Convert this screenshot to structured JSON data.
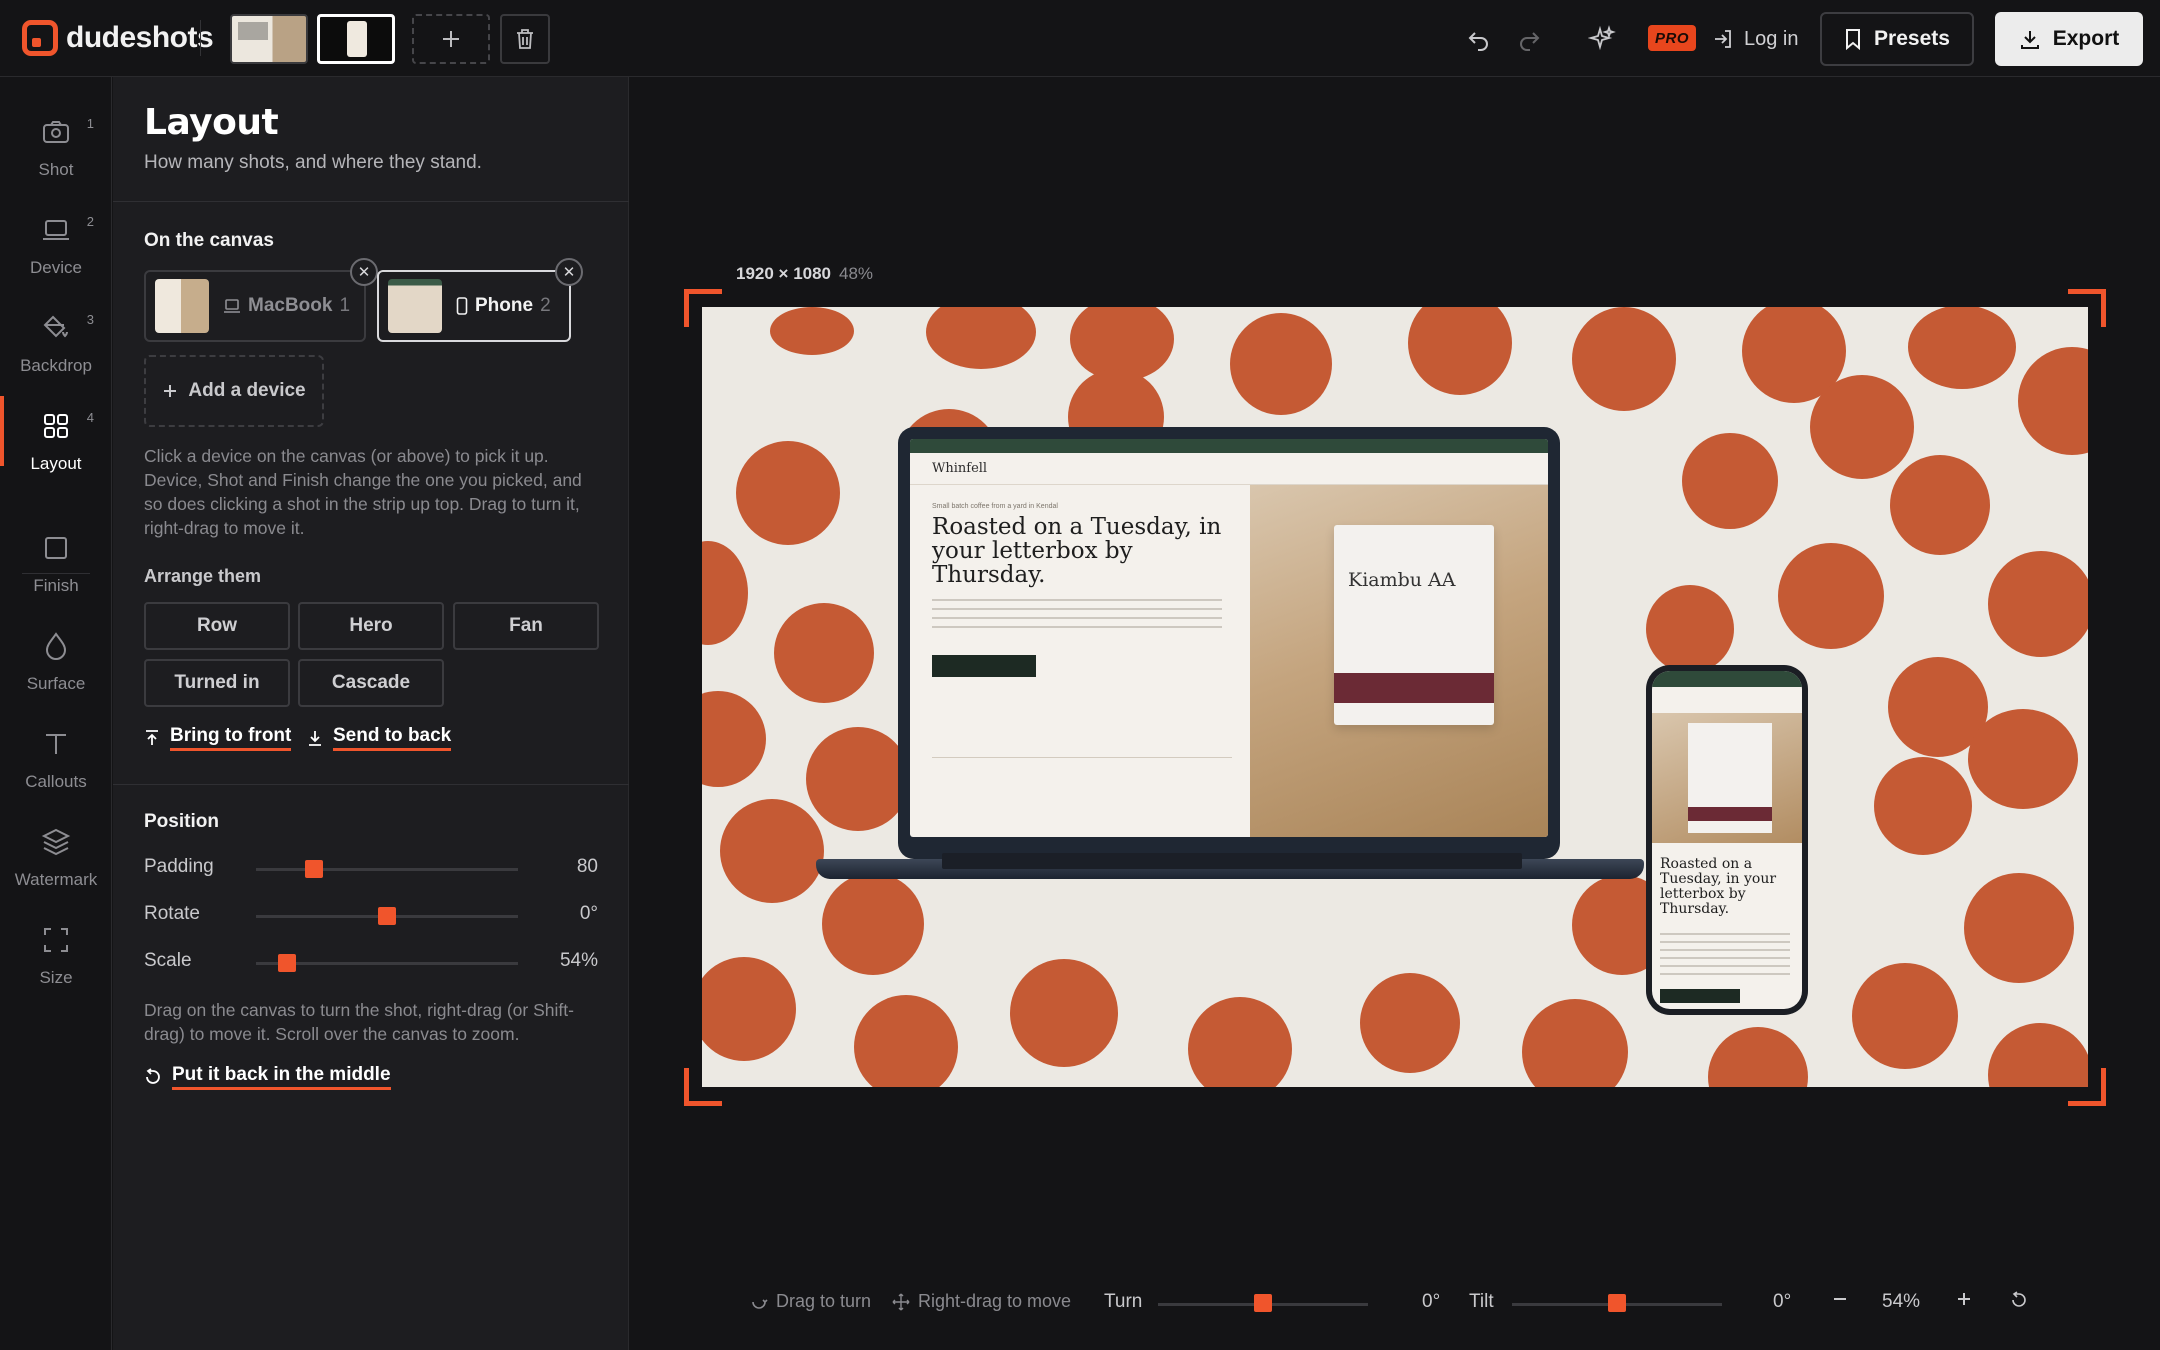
{
  "app": {
    "name": "dudeshots"
  },
  "topbar": {
    "login_label": "Log in",
    "presets_label": "Presets",
    "export_label": "Export",
    "pro_badge": "PRO"
  },
  "rail": {
    "items": [
      {
        "label": "Shot",
        "num": "1",
        "icon": "camera-icon"
      },
      {
        "label": "Device",
        "num": "2",
        "icon": "laptop-icon"
      },
      {
        "label": "Backdrop",
        "num": "3",
        "icon": "paint-bucket-icon"
      },
      {
        "label": "Layout",
        "num": "4",
        "icon": "grid-icon",
        "active": true
      },
      {
        "label": "Finish",
        "icon": "square-icon"
      },
      {
        "label": "Surface",
        "icon": "droplet-icon"
      },
      {
        "label": "Callouts",
        "icon": "text-icon"
      },
      {
        "label": "Watermark",
        "icon": "layers-icon"
      },
      {
        "label": "Size",
        "icon": "resize-icon"
      }
    ]
  },
  "panel": {
    "title": "Layout",
    "subtitle": "How many shots, and where they stand.",
    "on_canvas_title": "On the canvas",
    "devices": [
      {
        "label": "MacBook",
        "num": "1",
        "selected": false
      },
      {
        "label": "Phone",
        "num": "2",
        "selected": true
      }
    ],
    "add_device_label": "Add a device",
    "pick_help": "Click a device on the canvas (or above) to pick it up. Device, Shot and Finish change the one you picked, and so does clicking a shot in the strip up top. Drag to turn it, right-drag to move it.",
    "arrange_title": "Arrange them",
    "arrange_options": [
      "Row",
      "Hero",
      "Fan",
      "Turned in",
      "Cascade"
    ],
    "bring_front_label": "Bring to front",
    "send_back_label": "Send to back",
    "position_title": "Position",
    "sliders": [
      {
        "label": "Padding",
        "value": "80",
        "fraction": 0.22
      },
      {
        "label": "Rotate",
        "value": "0°",
        "fraction": 0.5
      },
      {
        "label": "Scale",
        "value": "54%",
        "fraction": 0.12
      }
    ],
    "drag_help": "Drag on the canvas to turn the shot, right-drag (or Shift-drag) to move it. Scroll over the canvas to zoom.",
    "reset_label": "Put it back in the middle"
  },
  "canvas": {
    "dimensions": "1920 × 1080",
    "zoom": "48%",
    "laptop_site": {
      "logo": "Whinfell",
      "kicker": "Small batch coffee from a yard in Kendal",
      "headline": "Roasted on a Tuesday, in your letterbox by Thursday.",
      "bag_title": "Kiambu AA"
    },
    "phone_site": {
      "headline": "Roasted on a Tuesday, in your letterbox by Thursday."
    }
  },
  "bottombar": {
    "drag_hint": "Drag to turn",
    "move_hint": "Right-drag to move",
    "turn_label": "Turn",
    "turn_value": "0°",
    "tilt_label": "Tilt",
    "tilt_value": "0°",
    "zoom_value": "54%"
  },
  "colors": {
    "accent": "#f0552c",
    "backdrop_dots": "#c55a34",
    "backdrop": "#ece9e3"
  }
}
